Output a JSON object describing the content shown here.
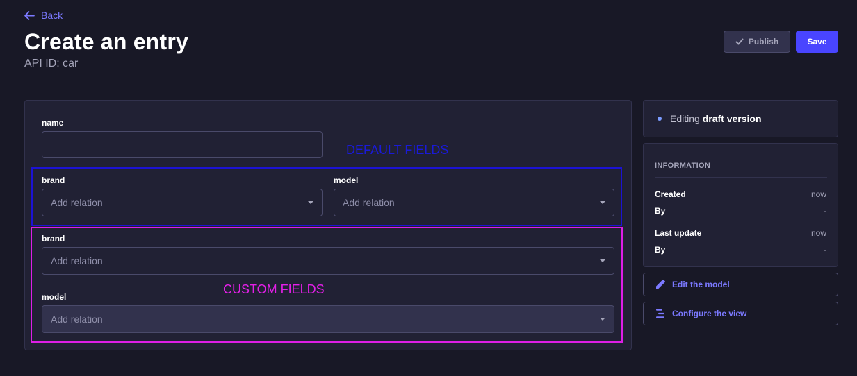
{
  "header": {
    "back_label": "Back",
    "title": "Create an entry",
    "api_id": "API ID: car",
    "publish_label": "Publish",
    "save_label": "Save"
  },
  "form": {
    "name_label": "name",
    "default_brand_label": "brand",
    "default_brand_placeholder": "Add relation",
    "default_model_label": "model",
    "default_model_placeholder": "Add relation",
    "custom_brand_label": "brand",
    "custom_brand_placeholder": "Add relation",
    "custom_model_label": "model",
    "custom_model_placeholder": "Add relation"
  },
  "annotations": {
    "default_fields": "DEFAULT FIELDS",
    "custom_fields": "CUSTOM FIELDS",
    "default_color": "#1c12d4",
    "custom_color": "#dd1ee6"
  },
  "sidebar": {
    "editing_prefix": "Editing",
    "editing_strong": "draft version",
    "info_title": "INFORMATION",
    "created_label": "Created",
    "created_value": "now",
    "created_by_label": "By",
    "created_by_value": "-",
    "updated_label": "Last update",
    "updated_value": "now",
    "updated_by_label": "By",
    "updated_by_value": "-",
    "edit_model_label": "Edit the model",
    "configure_view_label": "Configure the view"
  },
  "colors": {
    "background": "#181826",
    "card": "#212134",
    "primary": "#4945ff",
    "link": "#7b79ff"
  },
  "icons": [
    "arrow-left-icon",
    "check-icon",
    "pencil-icon",
    "layout-icon",
    "caret-down-icon"
  ]
}
